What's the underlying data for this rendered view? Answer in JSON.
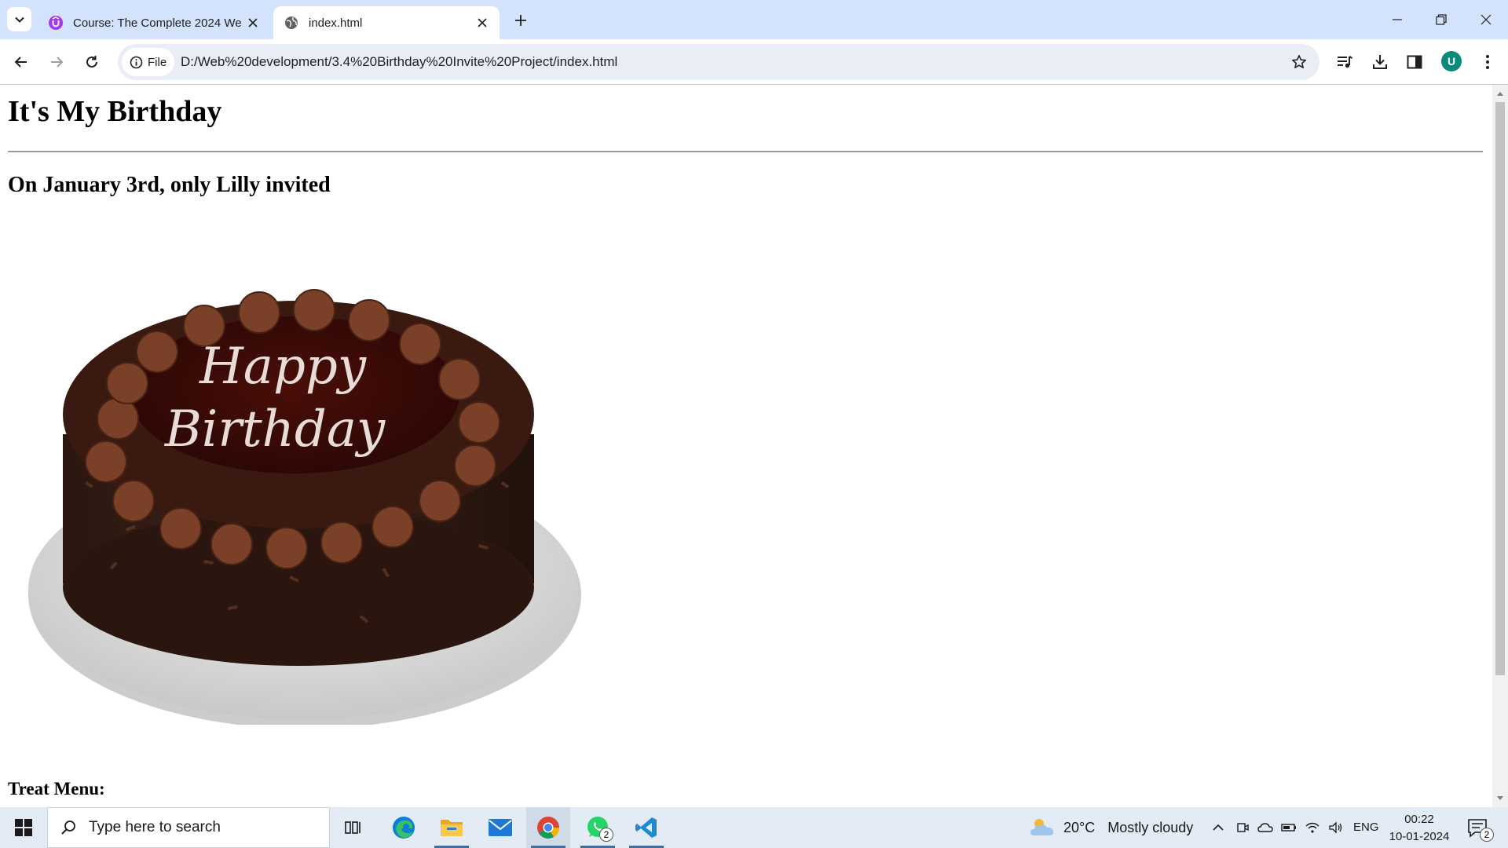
{
  "browser": {
    "tabs": [
      {
        "title": "Course: The Complete 2024 We",
        "favicon": "udemy-icon",
        "active": false
      },
      {
        "title": "index.html",
        "favicon": "globe-icon",
        "active": true
      }
    ],
    "site_chip_label": "File",
    "address": "D:/Web%20development/3.4%20Birthday%20Invite%20Project/index.html",
    "profile_initial": "U"
  },
  "page": {
    "heading": "It's My Birthday",
    "subheading": "On January 3rd, only Lilly invited",
    "cake_image": {
      "text_line1": "Happy",
      "text_line2": "Birthday"
    },
    "menu_heading": "Treat Menu:"
  },
  "taskbar": {
    "search_placeholder": "Type here to search",
    "apps": [
      "task-view",
      "edge",
      "file-explorer",
      "mail",
      "chrome",
      "whatsapp",
      "vscode"
    ],
    "whatsapp_badge": "2",
    "weather": {
      "temperature": "20°C",
      "condition": "Mostly cloudy"
    },
    "language": "ENG",
    "time": "00:22",
    "date": "10-01-2024",
    "notification_count": "2"
  },
  "colors": {
    "tabstrip": "#d3e3fd",
    "omnibox": "#e9eef6",
    "avatar": "#0b8a7a",
    "taskbar": "#e3ecf5"
  }
}
